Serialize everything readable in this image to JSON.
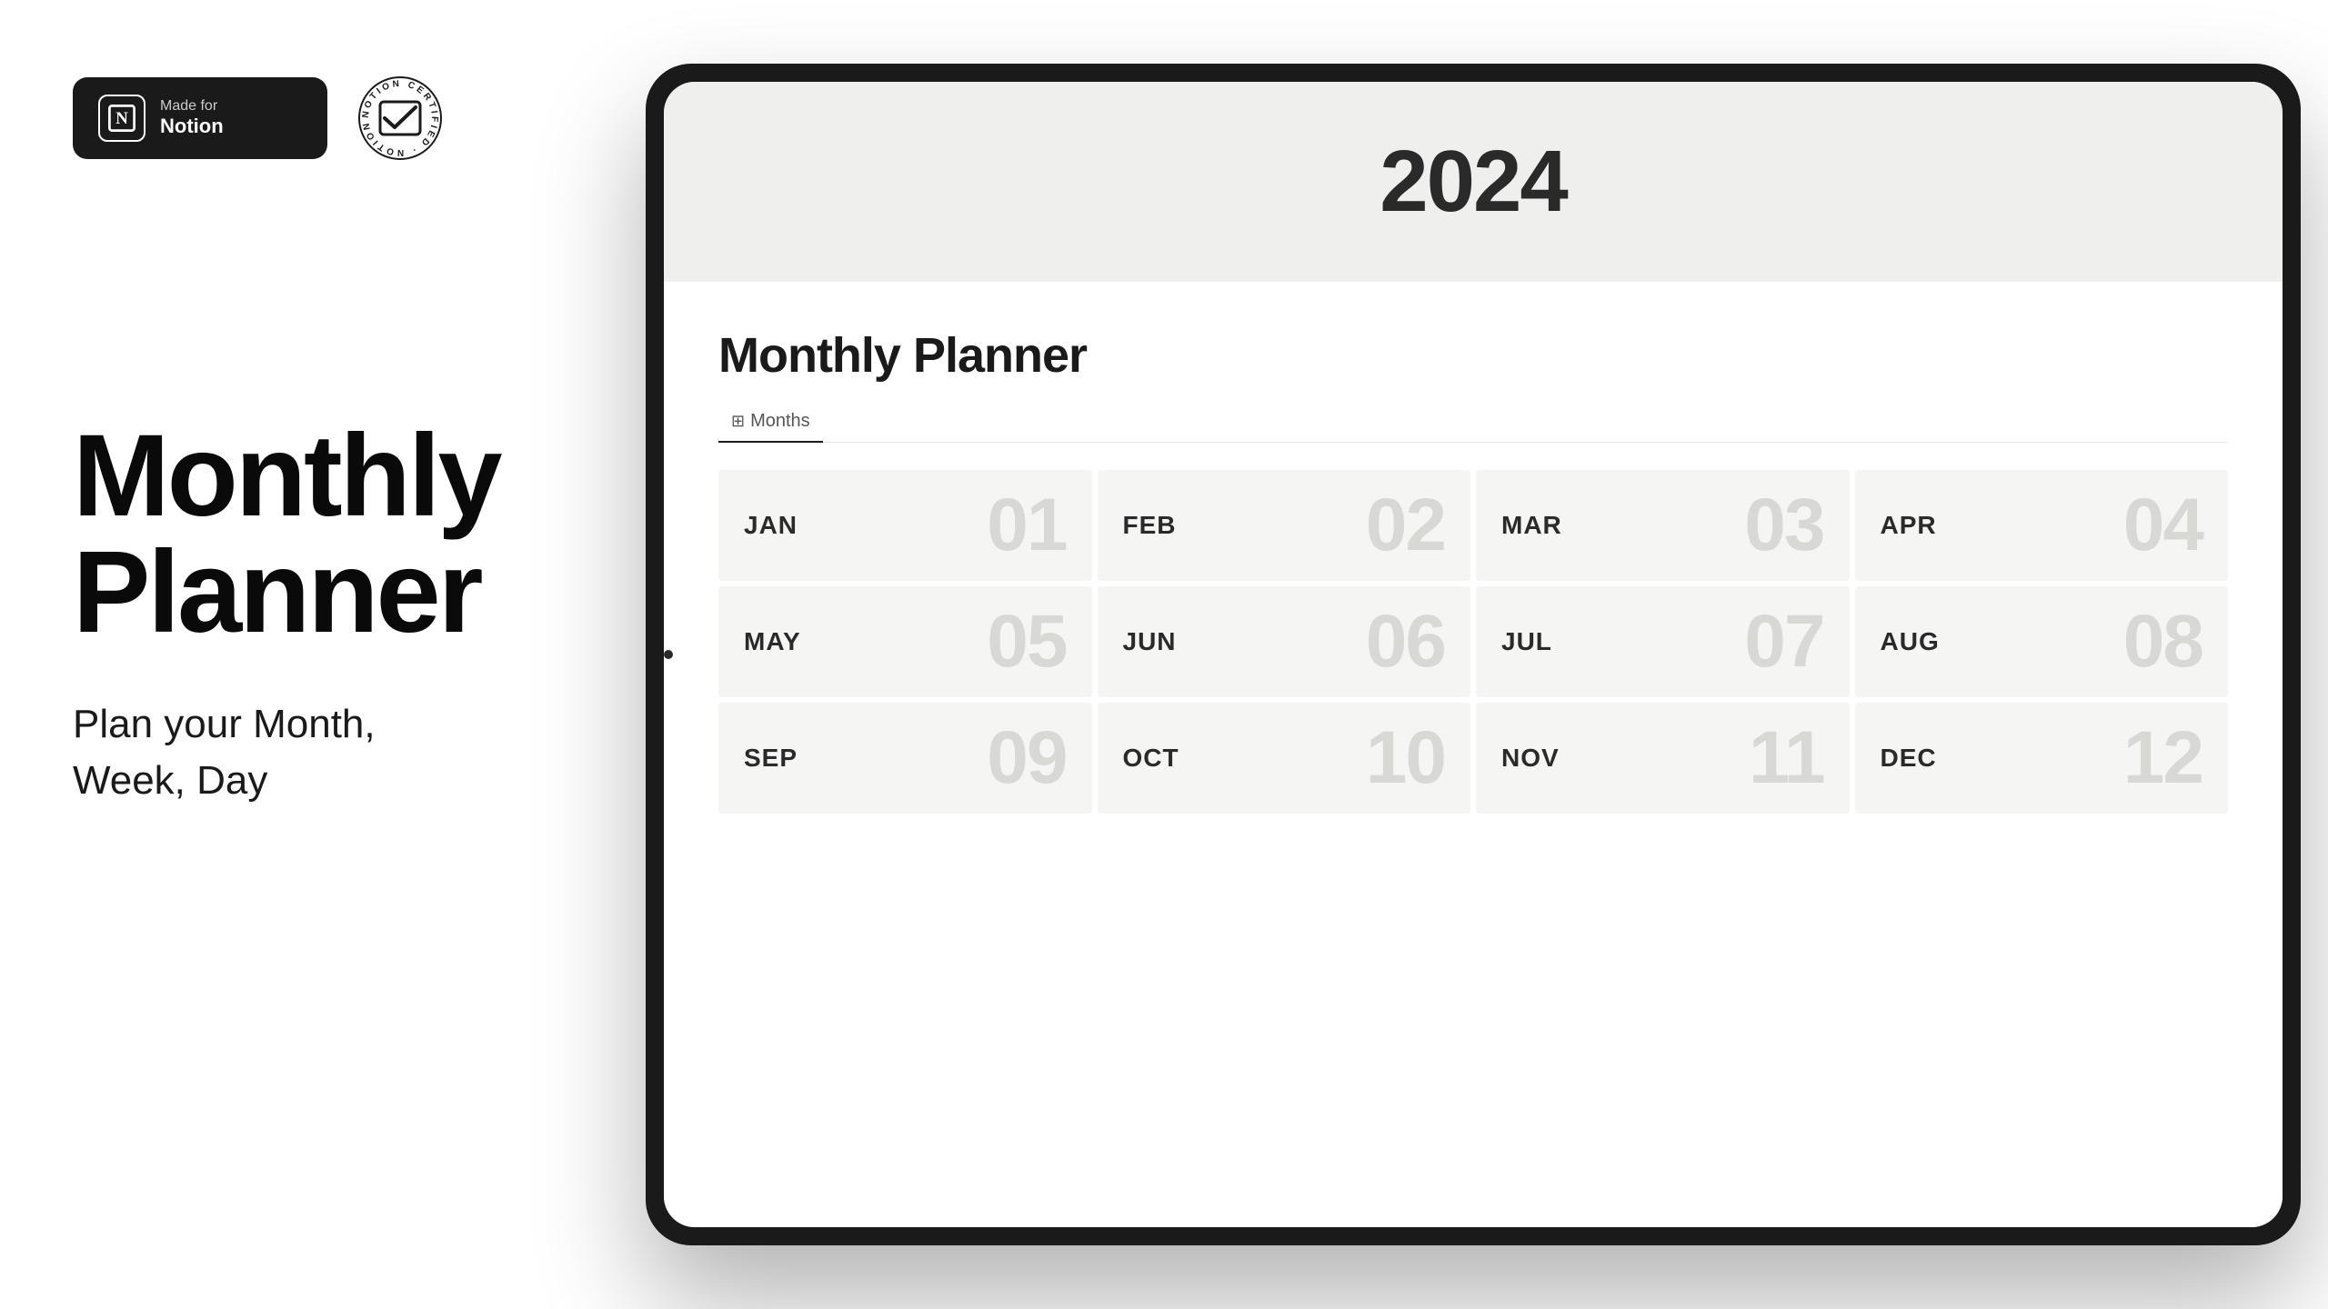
{
  "left": {
    "made_for_label": "Made for",
    "notion_label": "Notion",
    "main_title_line1": "Monthly",
    "main_title_line2": "Planner",
    "subtitle": "Plan your Month,\nWeek, Day"
  },
  "certified_stamp": {
    "text": "NOTION CERTIFIED NOTION CERTIFIED"
  },
  "screen": {
    "year": "2024",
    "page_title": "Monthly Planner",
    "view_tab_label": "Months",
    "months": [
      {
        "abbr": "JAN",
        "num": "01"
      },
      {
        "abbr": "FEB",
        "num": "02"
      },
      {
        "abbr": "MAR",
        "num": "03"
      },
      {
        "abbr": "APR",
        "num": "04"
      },
      {
        "abbr": "MAY",
        "num": "05"
      },
      {
        "abbr": "JUN",
        "num": "06"
      },
      {
        "abbr": "JUL",
        "num": "07"
      },
      {
        "abbr": "AUG",
        "num": "08"
      },
      {
        "abbr": "SEP",
        "num": "09"
      },
      {
        "abbr": "OCT",
        "num": "10"
      },
      {
        "abbr": "NOV",
        "num": "11"
      },
      {
        "abbr": "DEC",
        "num": "12"
      }
    ]
  }
}
